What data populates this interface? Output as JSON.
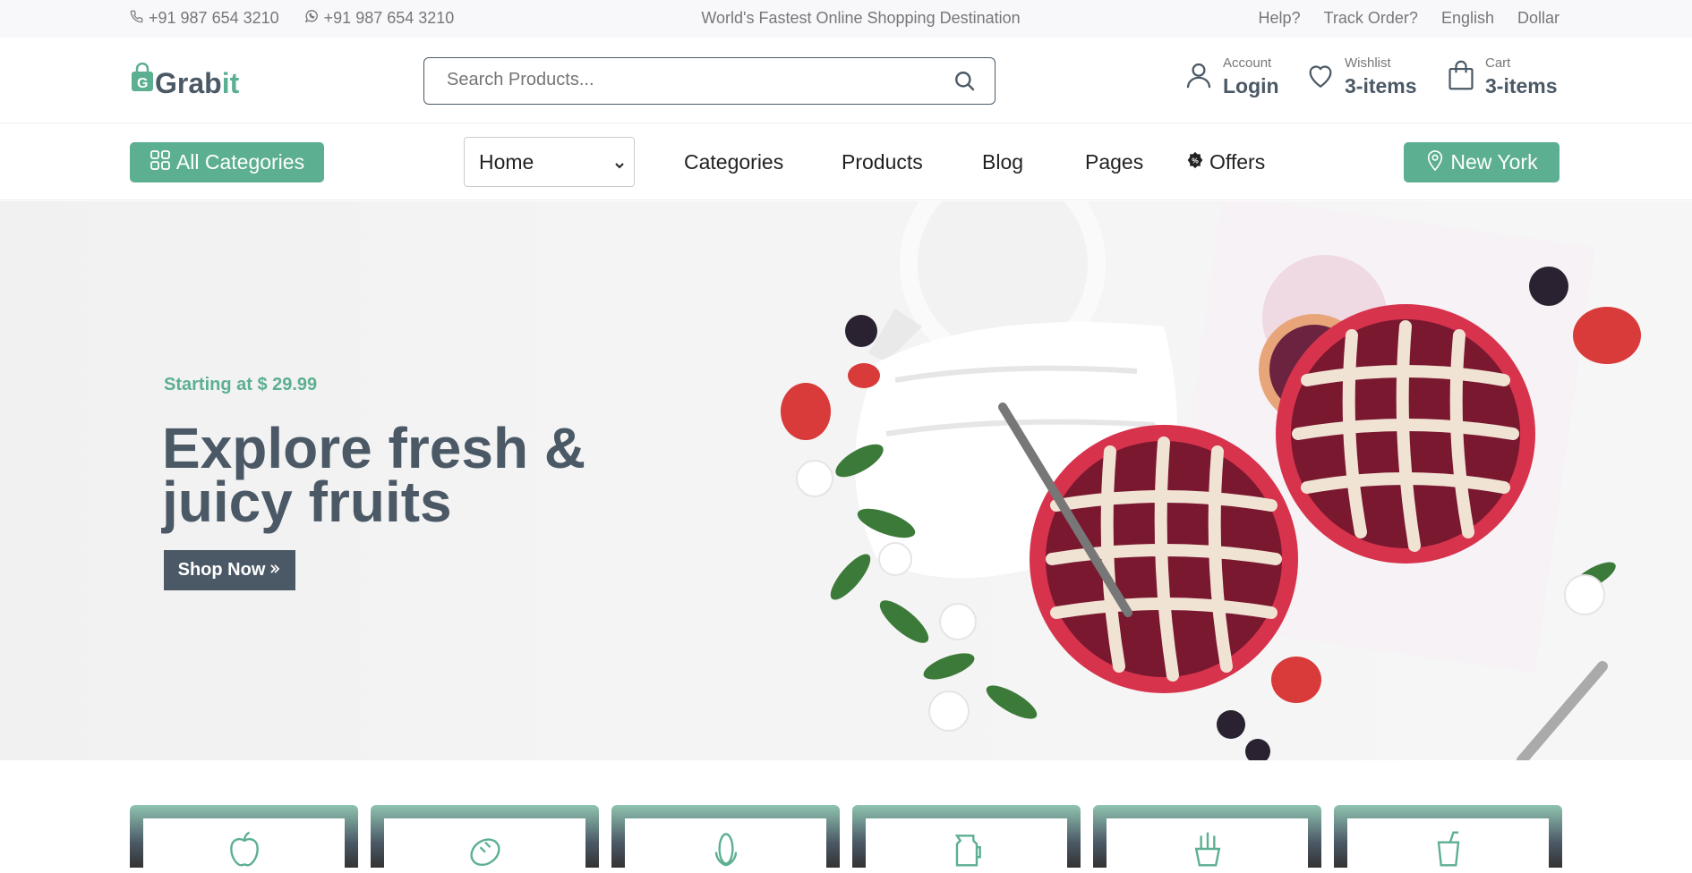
{
  "topbar": {
    "phone": "+91 987 654 3210",
    "whatsapp": "+91 987 654 3210",
    "tagline": "World's Fastest Online Shopping Destination",
    "help": "Help?",
    "track": "Track Order?",
    "language": "English",
    "currency": "Dollar"
  },
  "header": {
    "logo_main": "Grab",
    "logo_accent": "it",
    "search_placeholder": "Search Products...",
    "account_small": "Account",
    "account_big": "Login",
    "wishlist_small": "Wishlist",
    "wishlist_big": "3-items",
    "cart_small": "Cart",
    "cart_big": "3-items"
  },
  "nav": {
    "all_categories": "All Categories",
    "home": "Home",
    "links": [
      "Categories",
      "Products",
      "Blog",
      "Pages",
      "Offers"
    ],
    "location": "New York"
  },
  "hero": {
    "subtitle": "Starting at $ 29.99",
    "title": "Explore fresh & juicy fruits",
    "button": "Shop Now"
  },
  "categories": [
    "apple-icon",
    "bread-icon",
    "corn-icon",
    "juice-jar-icon",
    "snack-icon",
    "drink-icon"
  ],
  "colors": {
    "accent": "#5caf90",
    "dark": "#4b5966"
  }
}
